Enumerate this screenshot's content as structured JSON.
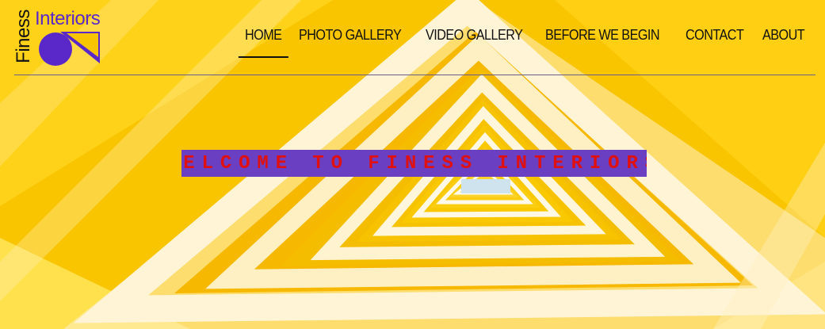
{
  "logo": {
    "word_vertical": "Finess",
    "word_horizontal": "Interiors",
    "colors": {
      "text_dark": "#111111",
      "brand_purple": "#5a28c8"
    }
  },
  "nav": {
    "items": [
      {
        "label": "HOME",
        "active": true
      },
      {
        "label": "PHOTO GALLERY",
        "active": false
      },
      {
        "label": "VIDEO GALLERY",
        "active": false
      },
      {
        "label": "BEFORE WE BEGIN",
        "active": false
      },
      {
        "label": "CONTACT",
        "active": false
      },
      {
        "label": "ABOUT",
        "active": false
      }
    ]
  },
  "hero": {
    "banner_text": "WELCOME TO FINESS INTERIORS",
    "banner_bg": "#6b3fc2",
    "banner_text_color": "#e01010",
    "image_description_icon": "yellow-triangular-staircase-image"
  }
}
